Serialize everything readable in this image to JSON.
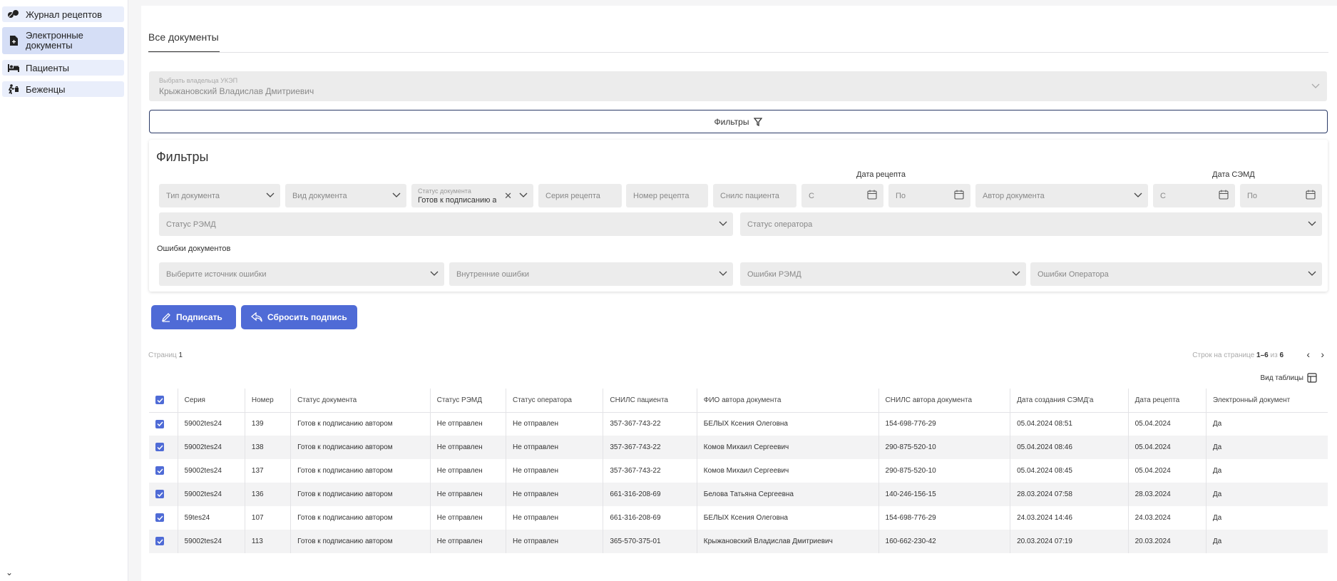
{
  "sidebar": {
    "items": [
      {
        "label": "Журнал рецептов",
        "icon": "pills-icon"
      },
      {
        "label": "Электронные документы",
        "icon": "document-icon"
      },
      {
        "label": "Пациенты",
        "icon": "bed-icon"
      },
      {
        "label": "Беженцы",
        "icon": "refugee-icon"
      }
    ],
    "collapse_glyph": "⌄"
  },
  "tabs": {
    "active": "Все документы"
  },
  "owner": {
    "label": "Выбрать владельца УКЭП",
    "value": "Крыжановский Владислав Дмитриевич"
  },
  "filters_button": {
    "label": "Фильтры"
  },
  "filter_panel": {
    "title": "Фильтры",
    "doc_type": "Тип документа",
    "doc_kind": "Вид документа",
    "doc_status_label": "Статус документа",
    "doc_status_value": "Готов к подписанию а...",
    "recipe_series": "Серия рецепта",
    "recipe_number": "Номер рецепта",
    "patient_snils": "Снилс пациента",
    "recipe_date_label": "Дата рецепта",
    "date_from": "С",
    "date_to": "По",
    "doc_author": "Автор документа",
    "semd_date_label": "Дата СЭМД",
    "remd_status": "Статус РЭМД",
    "operator_status": "Статус оператора",
    "errors_label": "Ошибки документов",
    "error_source": "Выберите источник ошибки",
    "internal_errors": "Внутренние ошибки",
    "remd_errors": "Ошибки РЭМД",
    "operator_errors": "Ошибки Оператора"
  },
  "actions": {
    "sign": "Подписать",
    "reset_sign": "Сбросить подпись"
  },
  "pagination": {
    "pages_label": "Страниц",
    "pages_value": "1",
    "rows_label": "Строк на странице",
    "rows_range": "1–6",
    "of_label": "из",
    "rows_total": "6"
  },
  "view_table": "Вид таблицы",
  "table": {
    "headers": [
      "Серия",
      "Номер",
      "Статус документа",
      "Статус РЭМД",
      "Статус оператора",
      "СНИЛС пациента",
      "ФИО автора документа",
      "СНИЛС автора документа",
      "Дата создания СЭМД'а",
      "Дата рецепта",
      "Электронный документ"
    ],
    "rows": [
      [
        "59002tes24",
        "139",
        "Готов к подписанию автором",
        "Не отправлен",
        "Не отправлен",
        "357-367-743-22",
        "БЕЛЫХ Ксения Олеговна",
        "154-698-776-29",
        "05.04.2024 08:51",
        "05.04.2024",
        "Да"
      ],
      [
        "59002tes24",
        "138",
        "Готов к подписанию автором",
        "Не отправлен",
        "Не отправлен",
        "357-367-743-22",
        "Комов Михаил Сергеевич",
        "290-875-520-10",
        "05.04.2024 08:46",
        "05.04.2024",
        "Да"
      ],
      [
        "59002tes24",
        "137",
        "Готов к подписанию автором",
        "Не отправлен",
        "Не отправлен",
        "357-367-743-22",
        "Комов Михаил Сергеевич",
        "290-875-520-10",
        "05.04.2024 08:45",
        "05.04.2024",
        "Да"
      ],
      [
        "59002tes24",
        "136",
        "Готов к подписанию автором",
        "Не отправлен",
        "Не отправлен",
        "661-316-208-69",
        "Белова Татьяна Сергеевна",
        "140-246-156-15",
        "28.03.2024 07:58",
        "28.03.2024",
        "Да"
      ],
      [
        "59tes24",
        "107",
        "Готов к подписанию автором",
        "Не отправлен",
        "Не отправлен",
        "661-316-208-69",
        "БЕЛЫХ Ксения Олеговна",
        "154-698-776-29",
        "24.03.2024 14:46",
        "24.03.2024",
        "Да"
      ],
      [
        "59002tes24",
        "113",
        "Готов к подписанию автором",
        "Не отправлен",
        "Не отправлен",
        "365-570-375-01",
        "Крыжановский Владислав Дмитриевич",
        "160-662-230-42",
        "20.03.2024 07:19",
        "20.03.2024",
        "Да"
      ]
    ]
  },
  "colors": {
    "accent": "#4f6bd6",
    "nav_bg": "#e9eefb",
    "nav_active": "#d5def6",
    "field_bg": "#ececec"
  }
}
